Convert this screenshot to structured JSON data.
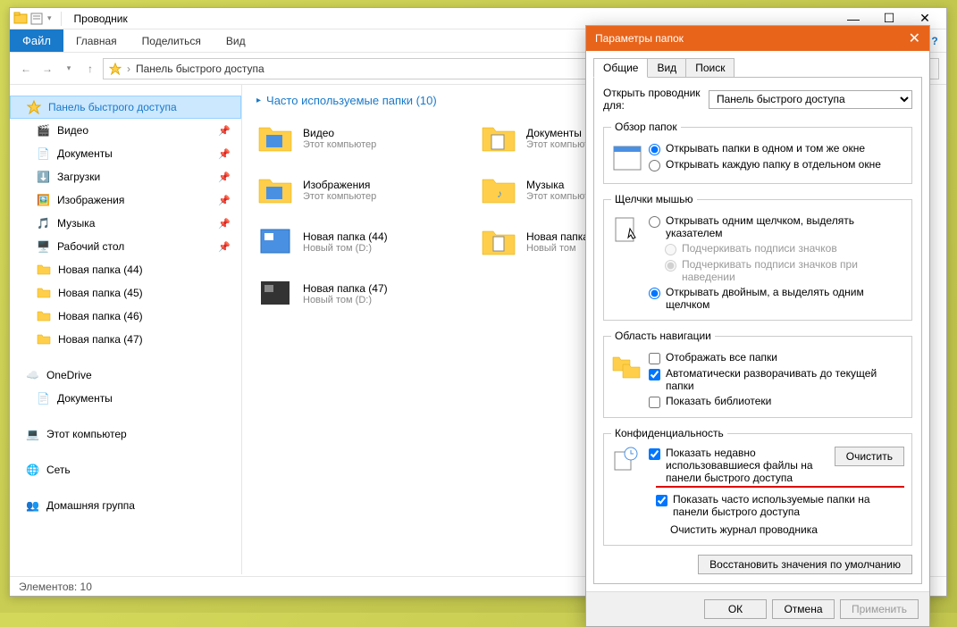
{
  "window": {
    "title": "Проводник",
    "tabs": {
      "file": "Файл",
      "home": "Главная",
      "share": "Поделиться",
      "view": "Вид"
    },
    "breadcrumb": "Панель быстрого доступа",
    "status": "Элементов: 10"
  },
  "sidebar": {
    "quick_access": "Панель быстрого доступа",
    "items": [
      {
        "label": "Видео",
        "pin": true,
        "icon": "video"
      },
      {
        "label": "Документы",
        "pin": true,
        "icon": "doc"
      },
      {
        "label": "Загрузки",
        "pin": true,
        "icon": "down"
      },
      {
        "label": "Изображения",
        "pin": true,
        "icon": "pic"
      },
      {
        "label": "Музыка",
        "pin": true,
        "icon": "music"
      },
      {
        "label": "Рабочий стол",
        "pin": true,
        "icon": "desk"
      },
      {
        "label": "Новая папка (44)",
        "pin": false,
        "icon": "folder"
      },
      {
        "label": "Новая папка (45)",
        "pin": false,
        "icon": "folder"
      },
      {
        "label": "Новая папка (46)",
        "pin": false,
        "icon": "folder"
      },
      {
        "label": "Новая папка (47)",
        "pin": false,
        "icon": "folder"
      }
    ],
    "onedrive": "OneDrive",
    "onedrive_docs": "Документы",
    "thispc": "Этот компьютер",
    "network": "Сеть",
    "homegroup": "Домашняя группа"
  },
  "main": {
    "header": "Часто используемые папки (10)",
    "folders": [
      {
        "name": "Видео",
        "sub": "Этот компьютер"
      },
      {
        "name": "Документы",
        "sub": "Этот компьютер"
      },
      {
        "name": "Изображения",
        "sub": "Этот компьютер"
      },
      {
        "name": "Музыка",
        "sub": "Этот компьютер"
      },
      {
        "name": "Новая папка (44)",
        "sub": "Новый том (D:)"
      },
      {
        "name": "Новая папка",
        "sub": "Новый том"
      },
      {
        "name": "Новая папка (47)",
        "sub": "Новый том (D:)"
      }
    ]
  },
  "dialog": {
    "title": "Параметры папок",
    "tabs": {
      "general": "Общие",
      "view": "Вид",
      "search": "Поиск"
    },
    "open_explorer_for": "Открыть проводник для:",
    "open_explorer_value": "Панель быстрого доступа",
    "browse_folders": {
      "legend": "Обзор папок",
      "same_window": "Открывать папки в одном и том же окне",
      "new_window": "Открывать каждую папку в отдельном окне"
    },
    "click": {
      "legend": "Щелчки мышью",
      "single": "Открывать одним щелчком, выделять указателем",
      "underline_always": "Подчеркивать подписи значков",
      "underline_hover": "Подчеркивать подписи значков при наведении",
      "double": "Открывать двойным, а выделять одним щелчком"
    },
    "navpane": {
      "legend": "Область навигации",
      "show_all": "Отображать все папки",
      "expand": "Автоматически разворачивать до текущей папки",
      "libs": "Показать библиотеки"
    },
    "privacy": {
      "legend": "Конфиденциальность",
      "recent_files": "Показать недавно использовавшиеся файлы на панели быстрого доступа",
      "frequent_folders": "Показать часто используемые папки на панели быстрого доступа",
      "clear": "Очистить",
      "clear_history": "Очистить журнал проводника"
    },
    "restore_defaults": "Восстановить значения по умолчанию",
    "ok": "ОК",
    "cancel": "Отмена",
    "apply": "Применить"
  }
}
